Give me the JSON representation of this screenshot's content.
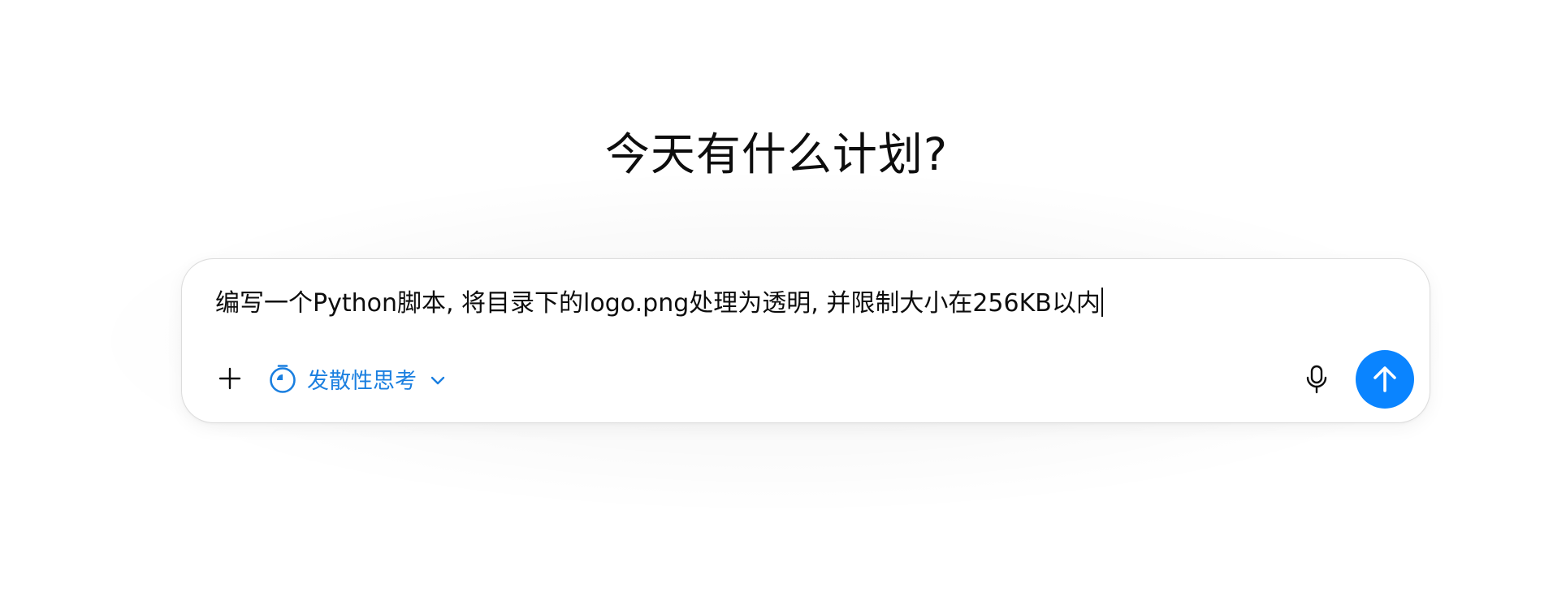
{
  "headline": "今天有什么计划?",
  "composer": {
    "input_value": "编写一个Python脚本, 将目录下的logo.png处理为透明, 并限制大小在256KB以内",
    "mode_label": "发散性思考",
    "icons": {
      "add": "plus-icon",
      "mode": "timer-icon",
      "mode_dropdown": "chevron-down-icon",
      "voice": "microphone-icon",
      "send": "arrow-up-icon"
    }
  },
  "colors": {
    "accent": "#0a84ff",
    "mode_text": "#1a7fe0",
    "text": "#0d0d0d",
    "border": "#dcdcdc"
  }
}
